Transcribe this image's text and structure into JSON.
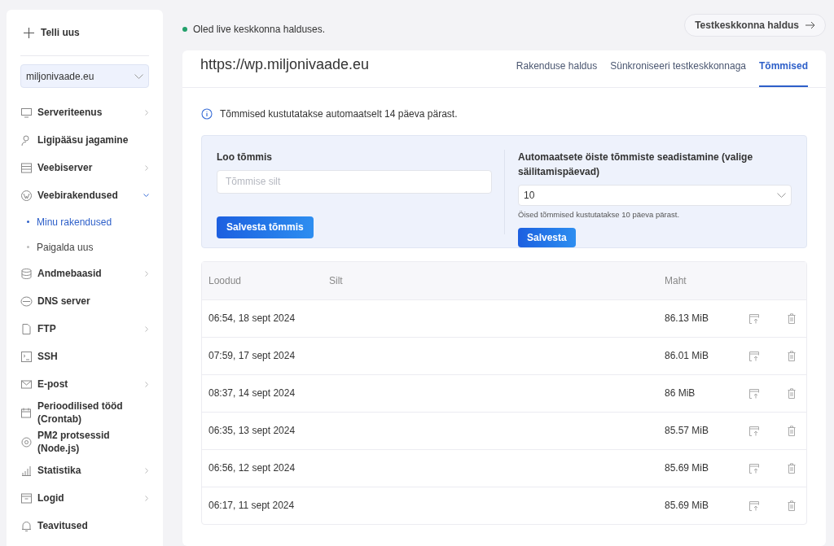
{
  "sidebar": {
    "order_button": "Telli uus",
    "domain_select": "miljonivaade.eu",
    "items": [
      {
        "label": "Serveriteenus",
        "expanded": false
      },
      {
        "label": "Ligipääsu jagamine"
      },
      {
        "label": "Veebiserver",
        "expanded": false
      },
      {
        "label": "Veebirakendused",
        "expanded": true,
        "children": [
          {
            "label": "Minu rakendused",
            "selected": true
          },
          {
            "label": "Paigalda uus",
            "selected": false
          }
        ]
      },
      {
        "label": "Andmebaasid",
        "expanded": false
      },
      {
        "label": "DNS server"
      },
      {
        "label": "FTP",
        "expanded": false
      },
      {
        "label": "SSH"
      },
      {
        "label": "E-post",
        "expanded": false
      },
      {
        "label": "Perioodilised tööd (Crontab)"
      },
      {
        "label": "PM2 protsessid (Node.js)"
      },
      {
        "label": "Statistika",
        "expanded": false
      },
      {
        "label": "Logid",
        "expanded": false
      },
      {
        "label": "Teavitused"
      }
    ]
  },
  "status": {
    "text": "Oled live keskkonna halduses.",
    "color": "#22a06b"
  },
  "test_env_button": "Testkeskkonna haldus",
  "app": {
    "url": "https://wp.miljonivaade.eu",
    "tabs": [
      {
        "label": "Rakenduse haldus",
        "selected": false
      },
      {
        "label": "Sünkroniseeri testkeskkonnaga",
        "selected": false
      },
      {
        "label": "Tõmmised",
        "selected": true
      }
    ],
    "info": "Tõmmised kustutatakse automaatselt 14 päeva pärast.",
    "create": {
      "title": "Loo tõmmis",
      "placeholder": "Tõmmise silt",
      "button": "Salvesta tõmmis"
    },
    "nightly": {
      "title": "Automaatsete öiste tõmmiste seadistamine (valige säilitamispäevad)",
      "value": "10",
      "hint": "Öised tõmmised kustutatakse 10 päeva pärast.",
      "button": "Salvesta"
    },
    "table": {
      "columns": [
        "Loodud",
        "Silt",
        "Maht"
      ],
      "rows": [
        {
          "created": "06:54, 18 sept 2024",
          "size": "86.13 MiB"
        },
        {
          "created": "07:59, 17 sept 2024",
          "size": "86.01 MiB"
        },
        {
          "created": "08:37, 14 sept 2024",
          "size": "86 MiB"
        },
        {
          "created": "06:35, 13 sept 2024",
          "size": "85.57 MiB"
        },
        {
          "created": "06:56, 12 sept 2024",
          "size": "85.69 MiB"
        },
        {
          "created": "06:17, 11 sept 2024",
          "size": "85.69 MiB"
        }
      ]
    }
  }
}
